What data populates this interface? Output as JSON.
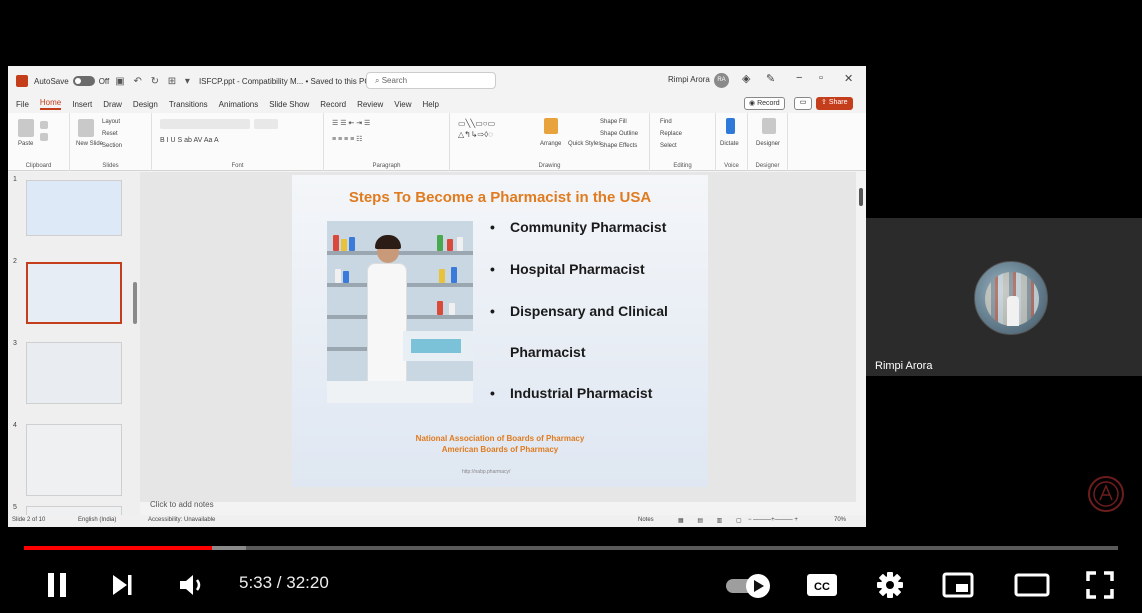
{
  "powerpoint": {
    "autosave_label": "AutoSave",
    "autosave_state": "Off",
    "doc_title": "ISFCP.ppt - Compatibility M... • Saved to this PC",
    "search_placeholder": "Search",
    "user_name": "Rimpi Arora",
    "user_initials": "RA",
    "menu": [
      "File",
      "Home",
      "Insert",
      "Draw",
      "Design",
      "Transitions",
      "Animations",
      "Slide Show",
      "Record",
      "Review",
      "View",
      "Help"
    ],
    "active_menu": "Home",
    "record_label": "Record",
    "share_label": "Share",
    "ribbon_groups": [
      "Clipboard",
      "Slides",
      "Font",
      "Paragraph",
      "Drawing",
      "Editing",
      "Voice",
      "Designer"
    ],
    "ribbon_items": {
      "paste": "Paste",
      "new_slide": "New Slide",
      "layout": "Layout",
      "reset": "Reset",
      "section": "Section",
      "arrange": "Arrange",
      "quick_styles": "Quick Styles",
      "shape_fill": "Shape Fill",
      "shape_outline": "Shape Outline",
      "shape_effects": "Shape Effects",
      "find": "Find",
      "replace": "Replace",
      "select": "Select",
      "dictate": "Dictate",
      "designer": "Designer"
    },
    "thumb_numbers": [
      "1",
      "2",
      "3",
      "4",
      "5"
    ],
    "notes_placeholder": "Click to add notes",
    "status_slide": "Slide 2 of 10",
    "status_language": "English (India)",
    "status_accessibility": "Accessibility: Unavailable",
    "status_notes": "Notes",
    "status_zoom": "70%"
  },
  "slide": {
    "title": "Steps To Become a Pharmacist in the USA",
    "bullets": [
      "Community Pharmacist",
      "Hospital Pharmacist",
      "Dispensary and Clinical",
      "Pharmacist",
      "Industrial Pharmacist"
    ],
    "footer_lines": [
      "National Association of Boards of Pharmacy",
      "American Boards of Pharmacy"
    ],
    "footer_url": "http://nabp.pharmacy/"
  },
  "participant": {
    "name": "Rimpi Arora"
  },
  "player": {
    "current_time": "5:33",
    "duration": "32:20",
    "time_display": "5:33 / 32:20",
    "progress_fraction": 0.172,
    "buffer_fraction": 0.203,
    "accent_color": "#ff0000"
  }
}
